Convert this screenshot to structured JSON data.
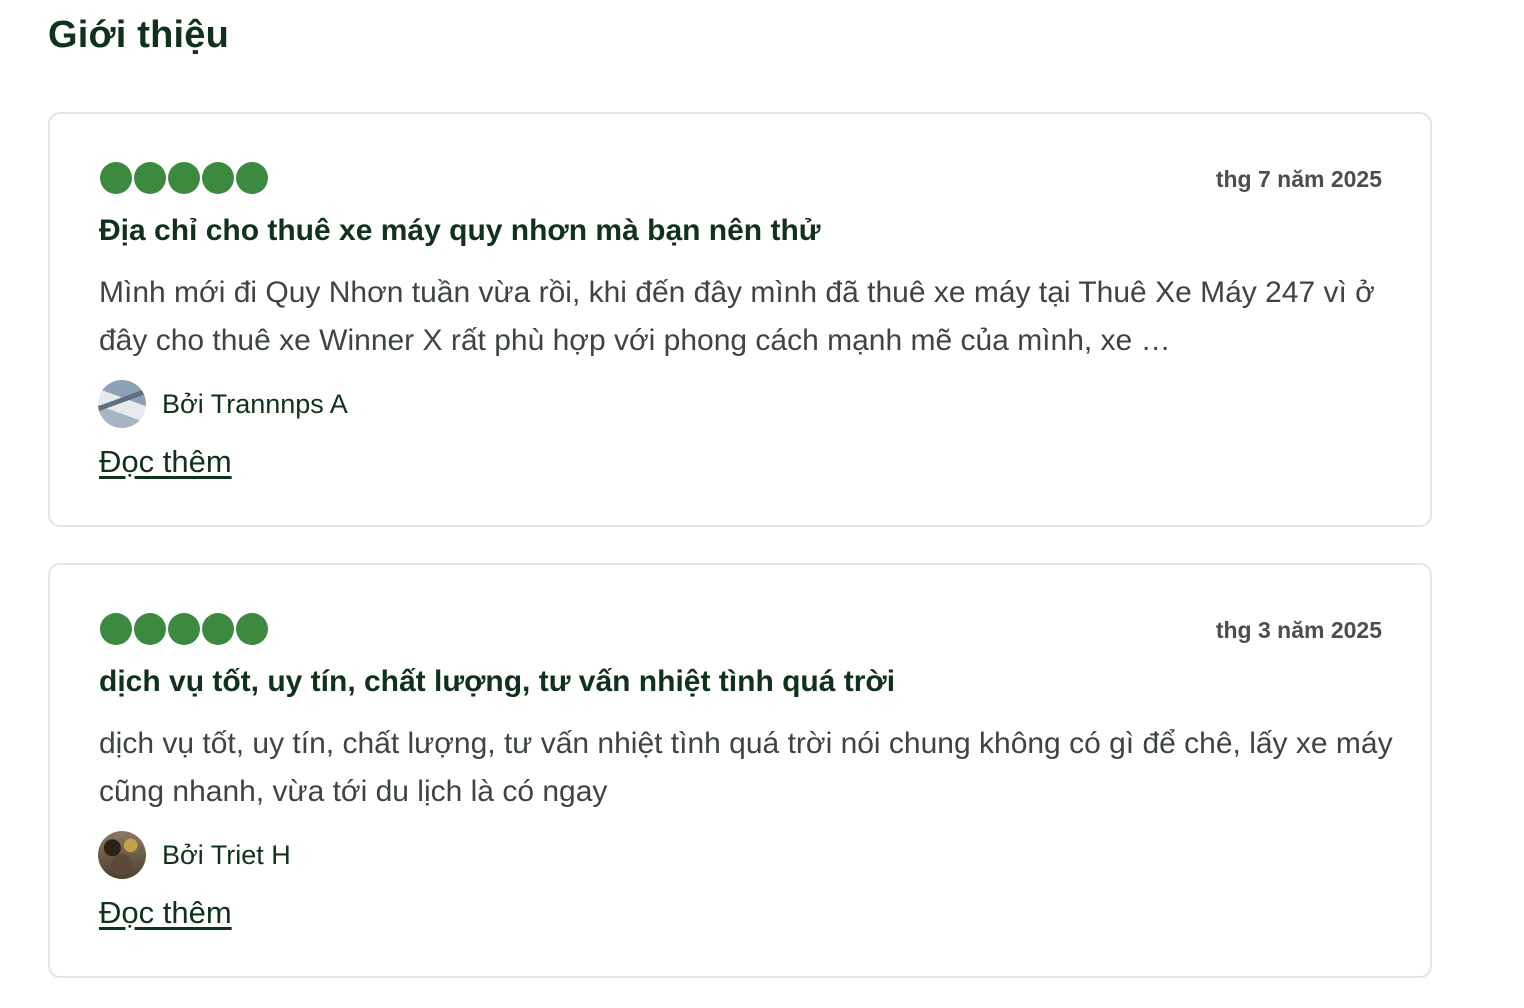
{
  "section": {
    "title": "Giới thiệu"
  },
  "reviews": [
    {
      "rating": 5,
      "date": "thg 7 năm 2025",
      "title": "Địa chỉ cho thuê xe máy quy nhơn mà bạn nên thử",
      "body": "Mình mới đi Quy Nhơn tuần vừa rồi, khi đến đây mình đã thuê xe máy tại Thuê Xe Máy 247 vì ở đây cho thuê xe Winner X rất phù hợp với phong cách mạnh mẽ của mình, xe …",
      "author": "Bởi Trannnps A",
      "read_more": "Đọc thêm"
    },
    {
      "rating": 5,
      "date": "thg 3 năm 2025",
      "title": "dịch vụ tốt, uy tín, chất lượng, tư vấn nhiệt tình quá trời",
      "body": "dịch vụ tốt, uy tín, chất lượng, tư vấn nhiệt tình quá trời nói chung không có gì để chê, lấy xe máy cũng nhanh, vừa tới du lịch là có ngay",
      "author": "Bởi Triet H",
      "read_more": "Đọc thêm"
    }
  ],
  "colors": {
    "rating_bubble": "#3b8a3f",
    "heading": "#10321c",
    "body_text": "#3e4541",
    "card_border": "#e2e5e3"
  }
}
